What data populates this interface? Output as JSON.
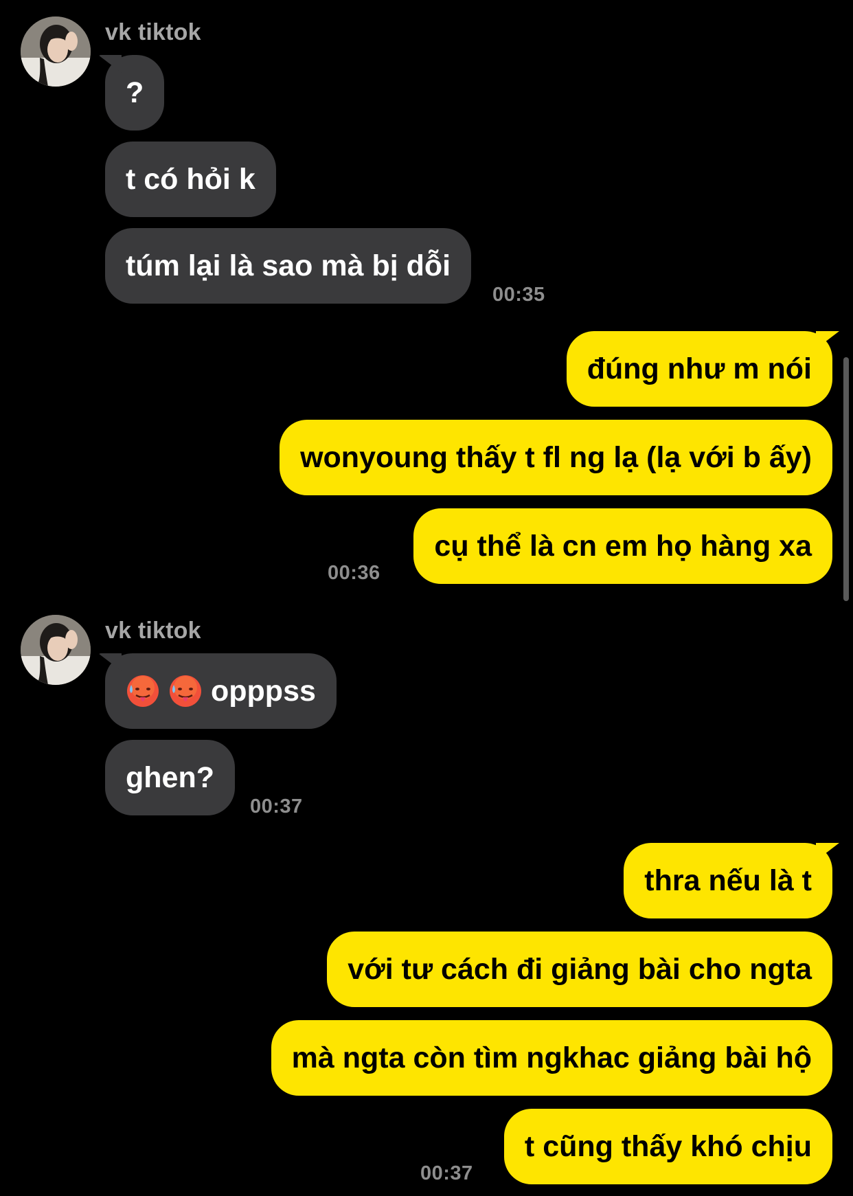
{
  "colors": {
    "background": "#000000",
    "incoming_bubble": "#3a3a3c",
    "outgoing_bubble": "#fee500",
    "timestamp": "#8e8e8e",
    "sender_name": "#a6a6a6"
  },
  "groups": [
    {
      "sender": "vk tiktok",
      "avatar_icon": "profile-photo",
      "messages": [
        "?",
        "t có hỏi k",
        "túm lại là sao mà bị dỗi"
      ],
      "time": "00:35"
    },
    {
      "sender": "",
      "messages": [
        "đúng như m nói",
        "wonyoung thấy t fl ng lạ (lạ với b ấy)",
        "cụ thể là cn em họ hàng xa"
      ],
      "time": "00:36"
    },
    {
      "sender": "vk tiktok",
      "avatar_icon": "profile-photo",
      "messages": [
        "opppss",
        "ghen?"
      ],
      "emoji_icons": [
        "hot-face-icon",
        "hot-face-icon"
      ],
      "time": "00:37"
    },
    {
      "sender": "",
      "messages": [
        "thra nếu là t",
        "với tư cách đi giảng bài cho ngta",
        "mà ngta còn tìm ngkhac giảng bài hộ",
        "t cũng thấy khó chịu"
      ],
      "time": "00:37"
    }
  ]
}
